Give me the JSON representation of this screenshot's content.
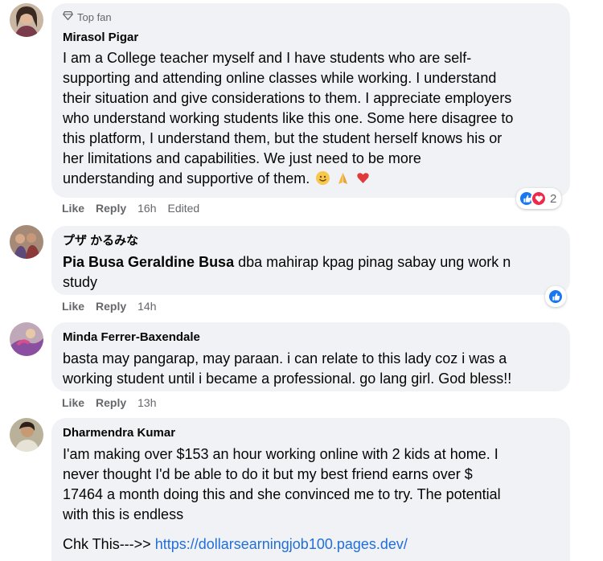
{
  "comments": [
    {
      "badge": "Top fan",
      "author": "Mirasol Pigar",
      "lines": [
        "I am a College teacher myself and I have students who are self-",
        "supporting and attending online classes while working. I understand",
        "their situation and give considerations to them. I appreciate employers",
        "who understand working students like this one. Some here disagree to",
        "this platform, I understand them, but the student herself knows his or",
        "her limitations and capabilities. We just need to be more",
        "understanding and supportive of them."
      ],
      "emojis": [
        "smiling-face-emoji",
        "folded-hands-emoji",
        "heart-emoji"
      ],
      "like_label": "Like",
      "reply_label": "Reply",
      "time": "16h",
      "edited": "Edited",
      "reaction_count": "2",
      "reaction_icons": [
        "like-icon",
        "love-icon"
      ]
    },
    {
      "author": "プザ かるみな",
      "mention": "Pia Busa Geraldine Busa",
      "lines": [
        " dba mahirap kpag pinag sabay ung work n",
        "study"
      ],
      "like_label": "Like",
      "reply_label": "Reply",
      "time": "14h",
      "reaction_icons": [
        "like-icon"
      ]
    },
    {
      "author": "Minda Ferrer-Baxendale",
      "lines": [
        "basta may pangarap, may paraan. i can relate to this lady coz i was a",
        "working student until i became a professional. go lang girl. God bless!!"
      ],
      "like_label": "Like",
      "reply_label": "Reply",
      "time": "13h"
    },
    {
      "author": "Dharmendra Kumar",
      "lines": [
        "I'am making over $153 an hour working online with 2 kids at home. I",
        "never thought I'd be able to do it but my best friend earns over $",
        "17464 a month doing this and she convinced me to try. The potential",
        "with this is endless"
      ],
      "link_prefix": "Chk This--->> ",
      "link_text": "https://dollarsearningjob100.pages.dev/"
    }
  ],
  "colors": {
    "bubble": "#f0f2f5",
    "meta_text": "#65676b",
    "like_blue": "#1877f2",
    "love_red": "#f02849",
    "link": "#216fdb"
  }
}
